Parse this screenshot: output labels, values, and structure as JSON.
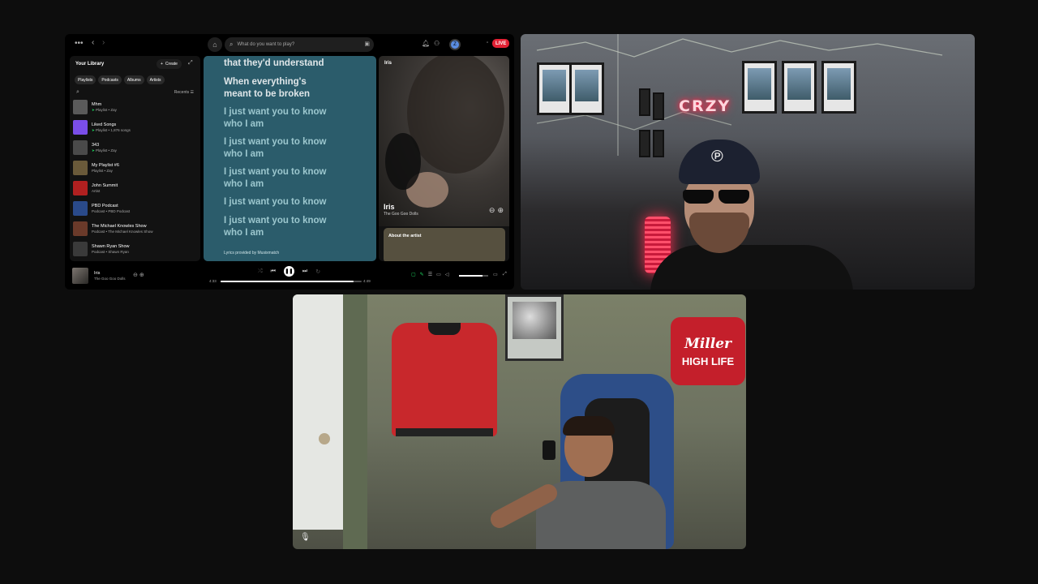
{
  "spotify": {
    "search_placeholder": "What do you want to play?",
    "live_badge": "LIVE",
    "avatar_letter": "Z",
    "library": {
      "title": "Your Library",
      "create_label": "Create",
      "chips": [
        "Playlists",
        "Podcasts",
        "Albums",
        "Artists"
      ],
      "sort_label": "Recents",
      "items": [
        {
          "name": "Mhm",
          "subtitle": "Playlist • Zay",
          "pinned": true,
          "thumb_color": "#5a5a5a"
        },
        {
          "name": "Liked Songs",
          "subtitle": "Playlist • 1,876 songs",
          "pinned": true,
          "thumb_color": "#7a4ee8"
        },
        {
          "name": "343",
          "subtitle": "Playlist • Zay",
          "pinned": true,
          "thumb_color": "#4a4a4a"
        },
        {
          "name": "My Playlist #6",
          "subtitle": "Playlist • Zay",
          "pinned": false,
          "thumb_color": "#6a5a3a"
        },
        {
          "name": "John Summit",
          "subtitle": "Artist",
          "pinned": false,
          "thumb_color": "#b02020"
        },
        {
          "name": "PBD Podcast",
          "subtitle": "Podcast • PBD Podcast",
          "pinned": false,
          "thumb_color": "#2a4a8a"
        },
        {
          "name": "The Michael Knowles Show",
          "subtitle": "Podcast • The Michael Knowles Show",
          "pinned": false,
          "thumb_color": "#6a3a2a"
        },
        {
          "name": "Shawn Ryan Show",
          "subtitle": "Podcast • Shawn Ryan",
          "pinned": false,
          "thumb_color": "#3a3a3a"
        }
      ]
    },
    "lyrics": {
      "lines": [
        {
          "text": "that they'd understand",
          "state": "past"
        },
        {
          "text": "When everything's meant to be broken",
          "state": "past"
        },
        {
          "text": "I just want you to know who I am",
          "state": "future"
        },
        {
          "text": "I just want you to know who I am",
          "state": "future"
        },
        {
          "text": "I just want you to know who I am",
          "state": "future"
        },
        {
          "text": "I just want you to know",
          "state": "future"
        },
        {
          "text": "I just want you to know who I am",
          "state": "future"
        }
      ],
      "footer": "Lyrics provided by Musixmatch"
    },
    "now_playing": {
      "panel_title": "Iris",
      "track": "Iris",
      "artist": "The Goo Goo Dolls",
      "about_label": "About the artist"
    },
    "player": {
      "track": "Iris",
      "artist": "The Goo Goo Dolls",
      "elapsed": "4:33",
      "duration": "4:49",
      "progress_fraction": 0.94,
      "volume_fraction": 0.8
    }
  },
  "cam1": {
    "neon_sign": "CRZY"
  },
  "cam2": {
    "sign_script": "Miller",
    "sign_text": "HIGH LIFE"
  },
  "colors": {
    "spotify_green": "#1ed760",
    "live_red": "#e22134",
    "lyrics_bg": "#2b5c6b"
  }
}
